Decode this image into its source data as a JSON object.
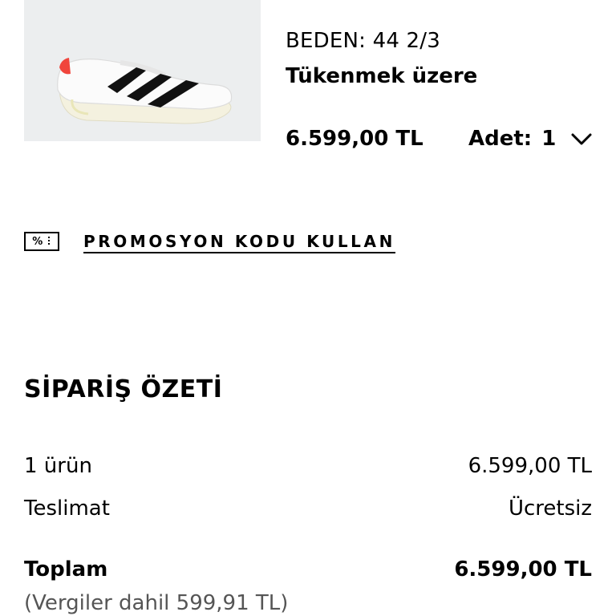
{
  "product": {
    "image_icon": "running-shoe-image",
    "size_label": "BEDEN:",
    "size_value": "44 2/3",
    "stock_status": "Tükenmek üzere",
    "price": "6.599,00 TL",
    "quantity_label": "Adet:",
    "quantity_value": "1",
    "quantity_icon": "chevron-down-icon"
  },
  "promo": {
    "icon": "percent-tag-icon",
    "icon_text": "%",
    "label": "PROMOSYON KODU KULLAN"
  },
  "summary": {
    "title": "SİPARİŞ ÖZETİ",
    "items_label": "1 ürün",
    "items_value": "6.599,00 TL",
    "delivery_label": "Teslimat",
    "delivery_value": "Ücretsiz",
    "total_label": "Toplam",
    "total_value": "6.599,00 TL",
    "tax_note": "(Vergiler dahil 599,91 TL)"
  },
  "colors": {
    "image_background": "#eceeef",
    "text": "#000000",
    "muted_text": "#555555",
    "shoe_accent": "#f0453c"
  }
}
